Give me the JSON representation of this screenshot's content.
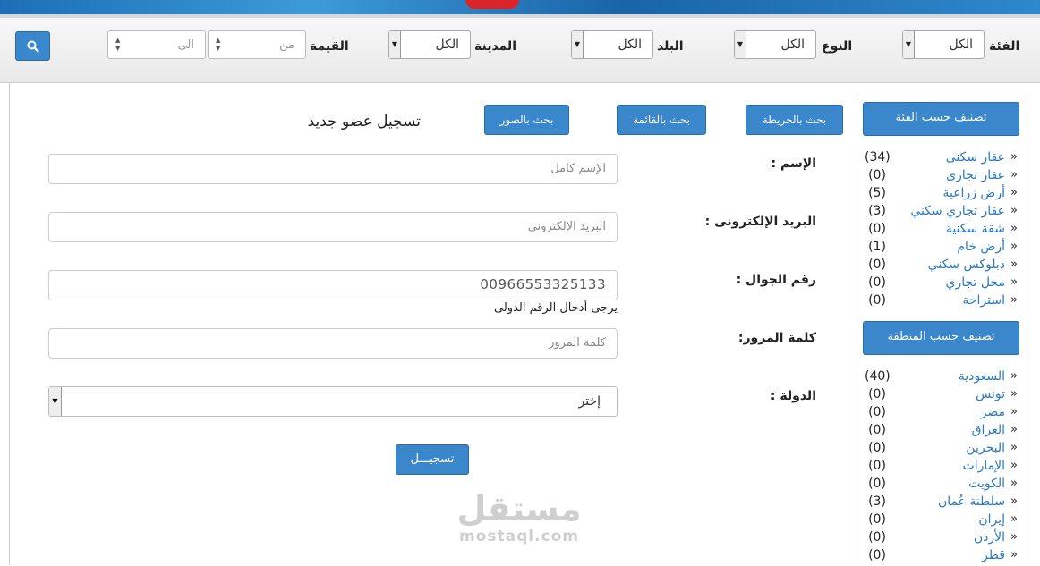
{
  "filters": {
    "category_label": "الفئة",
    "category_value": "الكل",
    "type_label": "النوع",
    "type_value": "الكل",
    "country_label": "البلد",
    "country_value": "الكل",
    "city_label": "المدينة",
    "city_value": "الكل",
    "price_label": "القيمة",
    "from_placeholder": "من",
    "to_placeholder": "الى"
  },
  "tabs": {
    "map": "بحث بالخريطة",
    "list": "بحث بالقائمة",
    "photos": "بحث بالصور"
  },
  "form": {
    "title": "تسجيل عضو جديد",
    "name_label": "الإسم :",
    "name_placeholder": "الإسم كامل",
    "email_label": "البريد الإلكترونى :",
    "email_placeholder": "البريد الإلكترونى",
    "mobile_label": "رقم الجوال :",
    "mobile_value": "00966553325133",
    "mobile_hint": "يرجى أدخال الرقم الدولى",
    "password_label": "كلمة المرور:",
    "password_placeholder": "كلمة المرور",
    "country_label": "الدولة :",
    "country_value": "إختر",
    "submit": "تسجيـــل"
  },
  "sidebar": {
    "category_heading": "تصنيف حسب الفئة",
    "categories": [
      {
        "name": "عقار سكنى",
        "count": "(34)"
      },
      {
        "name": "عقار تجارى",
        "count": "(0)"
      },
      {
        "name": "أرض زراعية",
        "count": "(5)"
      },
      {
        "name": "عقار تجاري سكني",
        "count": "(3)"
      },
      {
        "name": "شقة سكنية",
        "count": "(0)"
      },
      {
        "name": "أرض خام",
        "count": "(1)"
      },
      {
        "name": "دبلوكس سكني",
        "count": "(0)"
      },
      {
        "name": "محل تجاري",
        "count": "(0)"
      },
      {
        "name": "استراحة",
        "count": "(0)"
      }
    ],
    "region_heading": "تصنيف حسب المنطقة",
    "regions": [
      {
        "name": "السعودية",
        "count": "(40)"
      },
      {
        "name": "تونس",
        "count": "(0)"
      },
      {
        "name": "مصر",
        "count": "(0)"
      },
      {
        "name": "العراق",
        "count": "(0)"
      },
      {
        "name": "البحرين",
        "count": "(0)"
      },
      {
        "name": "الإمارات",
        "count": "(0)"
      },
      {
        "name": "الكويت",
        "count": "(0)"
      },
      {
        "name": "سلطنة عُمان",
        "count": "(3)"
      },
      {
        "name": "إيران",
        "count": "(0)"
      },
      {
        "name": "الأردن",
        "count": "(0)"
      },
      {
        "name": "قطر",
        "count": "(0)"
      }
    ]
  },
  "watermark": {
    "arabic": "مستقل",
    "latin": "mostaql.com"
  },
  "colors": {
    "accent": "#3a87cc",
    "link": "#2a7ac0"
  }
}
